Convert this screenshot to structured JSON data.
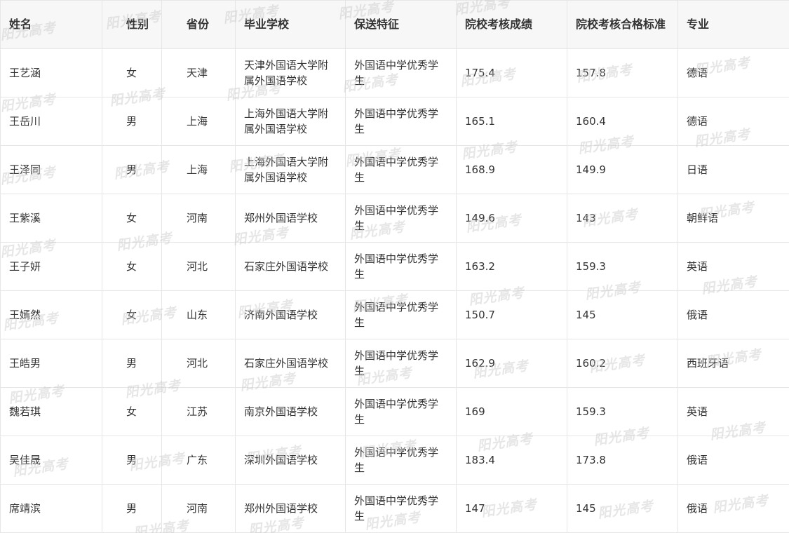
{
  "table": {
    "headers": [
      "姓名",
      "性别",
      "省份",
      "毕业学校",
      "保送特征",
      "院校考核成绩",
      "院校考核合格标准",
      "专业"
    ],
    "rows": [
      [
        "王艺涵",
        "女",
        "天津",
        "天津外国语大学附属外国语学校",
        "外国语中学优秀学生",
        "175.4",
        "157.8",
        "德语"
      ],
      [
        "王岳川",
        "男",
        "上海",
        "上海外国语大学附属外国语学校",
        "外国语中学优秀学生",
        "165.1",
        "160.4",
        "德语"
      ],
      [
        "王泽同",
        "男",
        "上海",
        "上海外国语大学附属外国语学校",
        "外国语中学优秀学生",
        "168.9",
        "149.9",
        "日语"
      ],
      [
        "王紫溪",
        "女",
        "河南",
        "郑州外国语学校",
        "外国语中学优秀学生",
        "149.6",
        "143",
        "朝鲜语"
      ],
      [
        "王子妍",
        "女",
        "河北",
        "石家庄外国语学校",
        "外国语中学优秀学生",
        "163.2",
        "159.3",
        "英语"
      ],
      [
        "王嫣然",
        "女",
        "山东",
        "济南外国语学校",
        "外国语中学优秀学生",
        "150.7",
        "145",
        "俄语"
      ],
      [
        "王皓男",
        "男",
        "河北",
        "石家庄外国语学校",
        "外国语中学优秀学生",
        "162.9",
        "160.2",
        "西班牙语"
      ],
      [
        "魏若琪",
        "女",
        "江苏",
        "南京外国语学校",
        "外国语中学优秀学生",
        "169",
        "159.3",
        "英语"
      ],
      [
        "吴佳晟",
        "男",
        "广东",
        "深圳外国语学校",
        "外国语中学优秀学生",
        "183.4",
        "173.8",
        "俄语"
      ],
      [
        "席靖滨",
        "男",
        "河南",
        "郑州外国语学校",
        "外国语中学优秀学生",
        "147",
        "145",
        "俄语"
      ]
    ]
  },
  "watermark": {
    "text": "阳光高考"
  }
}
